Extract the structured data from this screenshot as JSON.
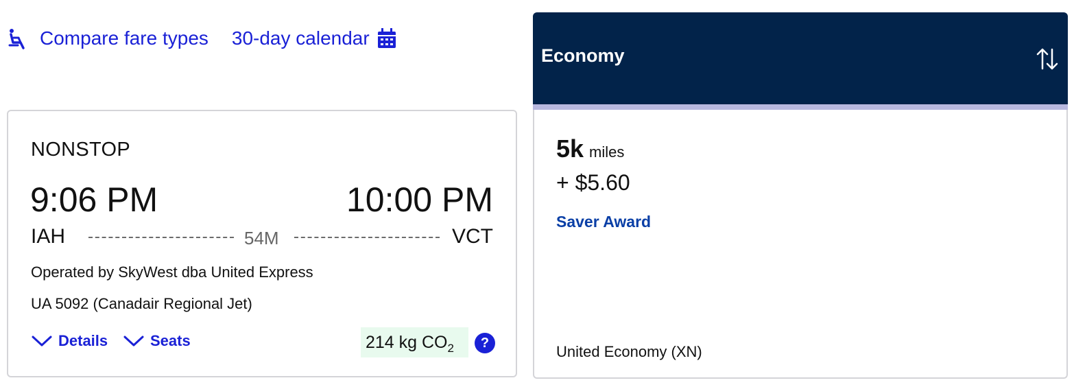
{
  "top_links": {
    "compare_label": "Compare fare types",
    "calendar_label": "30-day calendar"
  },
  "flight_card": {
    "stops": "NONSTOP",
    "departure_time": "9:06 PM",
    "arrival_time": "10:00 PM",
    "origin": "IAH",
    "destination": "VCT",
    "duration": "54M",
    "operated_by": "Operated by SkyWest dba United Express",
    "flight_info": "UA 5092 (Canadair Regional Jet)",
    "details_label": "Details",
    "seats_label": "Seats",
    "co2_value": "214 kg CO",
    "co2_subscript": "2",
    "help_label": "?"
  },
  "economy": {
    "header_title": "Economy",
    "miles_value": "5k",
    "miles_unit": "miles",
    "tax": "+ $5.60",
    "fare_type": "Saver Award",
    "cabin": "United Economy (XN)"
  },
  "colors": {
    "link_blue": "#1a21d6",
    "header_navy": "#02234a",
    "header_strip": "#b8b8df",
    "co2_bg": "#e8faee",
    "saver_blue": "#0a3fa6"
  },
  "icons": [
    "seat-icon",
    "calendar-icon",
    "chevron-down-icon",
    "help-icon",
    "sort-arrows-icon"
  ]
}
